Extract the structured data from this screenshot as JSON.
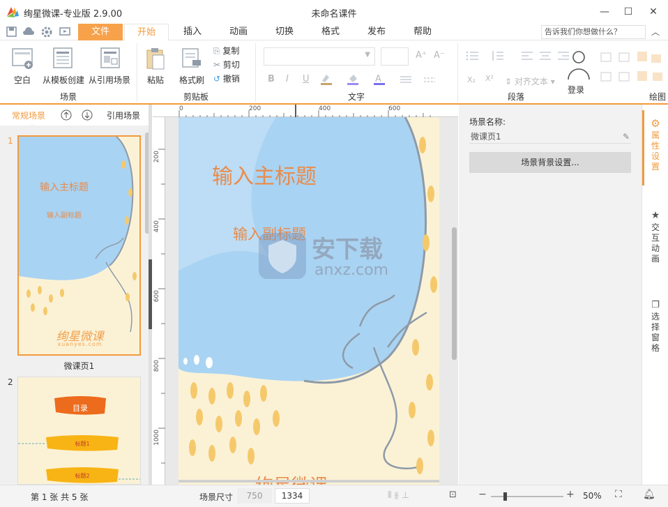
{
  "app": {
    "title": "绚星微课-专业版 2.9.00",
    "doc_title": "未命名课件"
  },
  "window": {
    "minimize": "—",
    "maximize": "☐",
    "close": "✕"
  },
  "menu": {
    "tabs": [
      "文件",
      "开始",
      "插入",
      "动画",
      "切换",
      "格式",
      "发布",
      "帮助"
    ],
    "help_search": "告诉我们你想做什么？",
    "collapse": "︿"
  },
  "ribbon": {
    "scene": {
      "blank": "空白",
      "from_template": "从模板创建",
      "from_ref": "从引用场景",
      "group": "场景"
    },
    "clipboard": {
      "paste": "粘贴",
      "format_painter": "格式刷",
      "copy": "复制",
      "cut": "剪切",
      "undo": "撤销",
      "group": "剪贴板"
    },
    "text": {
      "group": "文字",
      "bold": "B",
      "italic": "I",
      "underline": "U",
      "grow": "A⁺",
      "shrink": "A⁻"
    },
    "paragraph": {
      "group": "段落",
      "align_text": "对齐文本"
    },
    "drawing": {
      "group": "绘图"
    },
    "login": "登录"
  },
  "left_panel": {
    "tab_normal": "常规场景",
    "tab_ref": "引用场景",
    "slides": [
      {
        "num": "1",
        "title": "输入主标题",
        "subtitle": "输入副标题",
        "brand": "绚星微课",
        "brand_url": "xuanyes.com",
        "name": "微课页1"
      },
      {
        "num": "2",
        "toc": "目录",
        "item1": "标题1",
        "item2": "标题2"
      }
    ]
  },
  "canvas": {
    "ruler_top": [
      "0",
      "200",
      "400",
      "600"
    ],
    "ruler_left": [
      "200",
      "400",
      "600",
      "800",
      "1000"
    ],
    "main_title": "输入主标题",
    "sub_title": "输入副标题",
    "brand": "绚星微课",
    "watermark": "安下载",
    "watermark_url": "anxz.com"
  },
  "right_panel": {
    "scene_name_label": "场景名称:",
    "scene_name_value": "微课页1",
    "bg_button": "场景背景设置..."
  },
  "side_tabs": {
    "properties": "属性设置",
    "animation": "交互动画",
    "selection": "选择窗格"
  },
  "status": {
    "page_info": "第 1 张  共 5 张",
    "scene_size_label": "场景尺寸",
    "width": "750",
    "height": "1334",
    "zoom": "50%"
  },
  "colors": {
    "accent": "#f39a3c",
    "file_tab": "#f7a24b",
    "balloon": "#a9d3f2",
    "paper": "#fbf2d6",
    "title": "#e98b4a"
  }
}
